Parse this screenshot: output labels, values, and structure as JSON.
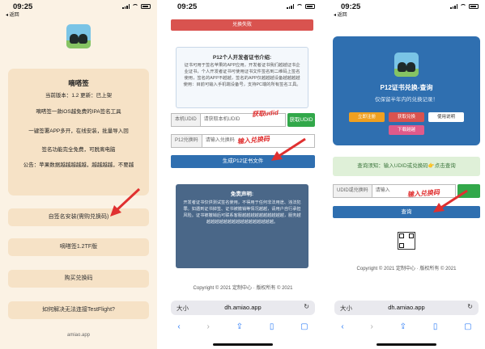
{
  "status": {
    "time": "09:25",
    "back": "◂ 返回"
  },
  "panel1": {
    "title": "嘀嗒签",
    "version": "当前版本：1.2  更新：已上架",
    "desc": [
      "嘀嗒签一款iOS越免费的IPA签名工具",
      "一键签署APP多开，在线安装，批量导入回",
      "签名功能完全免费，可脱离电脑",
      "公告：苹果数据越越越越越，越越越越，不要越"
    ],
    "buttons": [
      "自签名安装(需购兑换码)",
      "嘀嗒签1.2TF版",
      "购买兑换码",
      "如何解决无法连接TestFlight?"
    ],
    "url": "amiao.app"
  },
  "panel2": {
    "top_button": "兑换失败",
    "info_title": "P12个人开发者证书介绍:",
    "info_text": "证书可用于签名苹果的APP应用，开发者证书我们越越证书企业证书，个人开发者证书可使用证书文件签名到二维码上签名使用，签名的APP不越越，签名的APP仅越越越设备越越越越使用：目前可输入手机端设备号，支持PC端的所有签名工具。",
    "udid_label": "本机UDID",
    "udid_placeholder": "请获取本机UDID",
    "get_udid": "获取UDID",
    "code_label": "P12兑换码",
    "code_placeholder": "请输入兑换码",
    "generate": "生成P12证书文件",
    "notice_title": "免责声明:",
    "notice_text": "开发者证书仅供测试签名使用，不得用于任何非法用途、违法犯罪。如遇到证书掉签、证书被撤销等情况越越，请用户自行承担风险。证书被撤销后可联系客服越越越越越越越越越越，服务越越越越越越越越越越越越越越越越越。",
    "footer": "Copyright © 2021 定制中心 · 版权所有 © 2021",
    "url": "dh.amiao.app",
    "ann_udid": "获取udid",
    "ann_code": "输入兑换码"
  },
  "panel3": {
    "title": "P12证书兑换-查询",
    "subtitle": "仅保留半年内的兑换记录！",
    "btn_register": "立即注册",
    "btn_buy": "获取兑换",
    "btn_guide": "使用说明",
    "btn_down": "下载越越",
    "query_tip": "查询须知：输入UDID或兑换码👉点击查询",
    "input_label": "UDID或兑换码",
    "input_placeholder": "请输入",
    "query_btn": "查询",
    "footer": "Copyright © 2021 定制中心 · 版权所有 © 2021",
    "url": "dh.amiao.app",
    "ann_code": "输入兑换码"
  },
  "colors": {
    "accent_blue": "#2f6fb0",
    "green": "#32a84a",
    "cream": "#fbf2e4",
    "red": "#e03030"
  }
}
